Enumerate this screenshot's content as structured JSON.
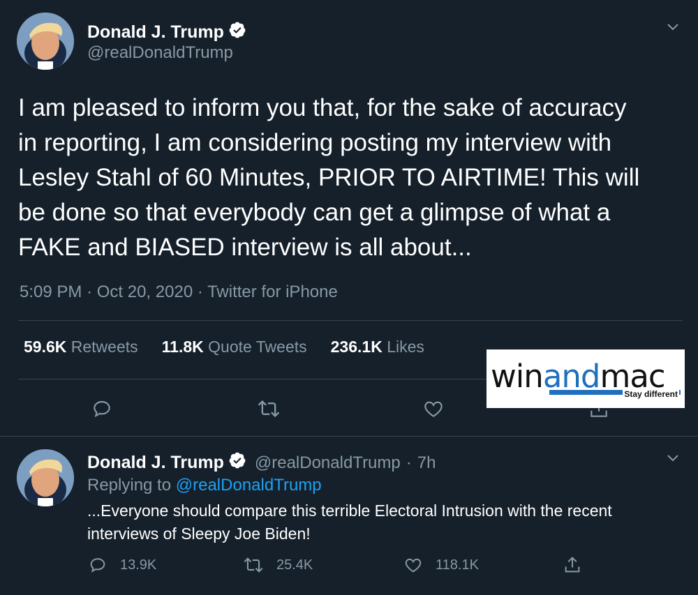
{
  "main_tweet": {
    "display_name": "Donald J. Trump",
    "handle": "@realDonaldTrump",
    "text_lines": [
      "I am pleased to inform you that, for the sake of accuracy",
      "in reporting, I am considering posting my interview with",
      "Lesley Stahl of 60 Minutes, PRIOR TO AIRTIME! This will",
      "be done so that everybody can get a glimpse of what a",
      "FAKE and BIASED interview is all about..."
    ],
    "time": "5:09 PM",
    "date": "Oct 20, 2020",
    "source": "Twitter for iPhone",
    "sep": "·",
    "stats": {
      "retweets_count": "59.6K",
      "retweets_label": "Retweets",
      "quotes_count": "11.8K",
      "quotes_label": "Quote Tweets",
      "likes_count": "236.1K",
      "likes_label": "Likes"
    }
  },
  "reply_tweet": {
    "display_name": "Donald J. Trump",
    "handle": "@realDonaldTrump",
    "sep": "·",
    "age": "7h",
    "replying_prefix": "Replying to",
    "replying_to": "@realDonaldTrump",
    "text_lines": [
      "...Everyone should compare this terrible Electoral Intrusion with the recent",
      "interviews of Sleepy Joe Biden!"
    ],
    "counts": {
      "replies": "13.9K",
      "retweets": "25.4K",
      "likes": "118.1K"
    }
  },
  "ad": {
    "logo_left": "win",
    "logo_mid": "and",
    "logo_right": "mac",
    "tagline": "Stay different"
  },
  "colors": {
    "background": "#15202b",
    "secondary_text": "#8899a6",
    "link": "#1da1f2",
    "verified": "#ffffff",
    "divider": "#38444d"
  },
  "icons": [
    "verified-badge-icon",
    "chevron-down-icon",
    "reply-icon",
    "retweet-icon",
    "like-icon",
    "share-icon"
  ]
}
